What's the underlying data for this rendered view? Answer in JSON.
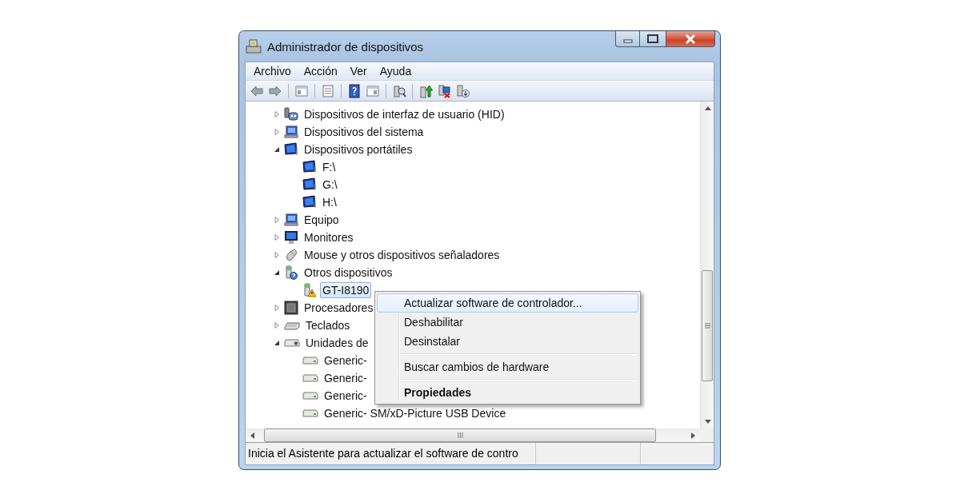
{
  "window": {
    "title": "Administrador de dispositivos"
  },
  "menubar": [
    "Archivo",
    "Acción",
    "Ver",
    "Ayuda"
  ],
  "tree": {
    "items": [
      {
        "label": "Dispositivos de interfaz de usuario (HID)",
        "expanded": false,
        "selected": false
      },
      {
        "label": "Dispositivos del sistema",
        "expanded": false,
        "selected": false
      },
      {
        "label": "Dispositivos portátiles",
        "expanded": true,
        "selected": false,
        "children": [
          {
            "label": "F:\\",
            "selected": false
          },
          {
            "label": "G:\\",
            "selected": false
          },
          {
            "label": "H:\\",
            "selected": false
          }
        ]
      },
      {
        "label": "Equipo",
        "expanded": false,
        "selected": false
      },
      {
        "label": "Monitores",
        "expanded": false,
        "selected": false
      },
      {
        "label": "Mouse y otros dispositivos señaladores",
        "expanded": false,
        "selected": false
      },
      {
        "label": "Otros dispositivos",
        "expanded": true,
        "selected": false,
        "children": [
          {
            "label": "GT-I8190",
            "selected": true
          }
        ]
      },
      {
        "label": "Procesadores",
        "expanded": false,
        "selected": false
      },
      {
        "label": "Teclados",
        "expanded": false,
        "selected": false
      },
      {
        "label": "Unidades de",
        "expanded": true,
        "selected": false,
        "children": [
          {
            "label": "Generic-",
            "selected": false
          },
          {
            "label": "Generic-",
            "selected": false
          },
          {
            "label": "Generic-",
            "selected": false
          },
          {
            "label": "Generic- SM/xD-Picture USB Device",
            "selected": false
          }
        ]
      }
    ]
  },
  "context_menu": {
    "items": [
      {
        "kind": "item",
        "label": "Actualizar software de controlador...",
        "selected": true,
        "default": false
      },
      {
        "kind": "item",
        "label": "Deshabilitar",
        "selected": false,
        "default": false
      },
      {
        "kind": "item",
        "label": "Desinstalar",
        "selected": false,
        "default": false
      },
      {
        "kind": "separator"
      },
      {
        "kind": "item",
        "label": "Buscar cambios de hardware",
        "selected": false,
        "default": false
      },
      {
        "kind": "separator"
      },
      {
        "kind": "item",
        "label": "Propiedades",
        "selected": false,
        "default": true
      }
    ]
  },
  "status_bar": {
    "text": "Inicia el Asistente para actualizar el software de contro"
  }
}
